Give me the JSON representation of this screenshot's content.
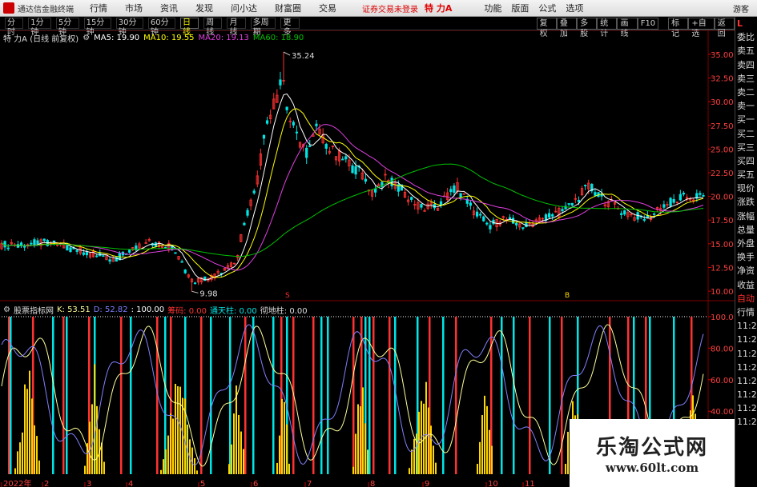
{
  "topbar": {
    "app_name": "通达信金融终端",
    "menus": [
      "行情",
      "市场",
      "资讯",
      "发现",
      "问小达",
      "财富圈",
      "交易"
    ],
    "notice": "证券交易未登录",
    "stock_title": "特 力A",
    "right_menus": [
      "功能",
      "版面",
      "公式",
      "选项"
    ],
    "guest": "游客"
  },
  "periods": [
    "分时",
    "1分钟",
    "5分钟",
    "15分钟",
    "30分钟",
    "60分钟",
    "日线",
    "周线",
    "月线",
    "多周期",
    "更多"
  ],
  "active_period": "日线",
  "tools": [
    "复权",
    "叠加",
    "多股",
    "统计",
    "画线",
    "F10",
    "标记",
    "+自选",
    "返回"
  ],
  "info": {
    "name": "特 力A (日线 前复权)",
    "ma5": "MA5: 19.90",
    "ma10": "MA10: 19.55",
    "ma20": "MA20: 19.13",
    "ma60": "MA60: 18.90"
  },
  "indicator": {
    "name": "股票指标网",
    "k": "K: 53.51",
    "d": "D: 52.82",
    "v100": ": 100.00",
    "chip": "筹码: 0.00",
    "sky": "通天柱: 0.00",
    "ground": "彻地柱: 0.00"
  },
  "price_axis": [
    "35.00",
    "32.50",
    "30.00",
    "27.50",
    "25.00",
    "22.50",
    "20.00",
    "17.50",
    "15.00",
    "12.50",
    "10.00"
  ],
  "ind_axis": [
    "100.0",
    "80.00",
    "60.00",
    "40.00"
  ],
  "annotations": {
    "high": "35.24",
    "low": "9.98",
    "mark1": "S",
    "mark2": "B"
  },
  "months": [
    "2022年",
    "2",
    "3",
    "4",
    "5",
    "6",
    "7",
    "8",
    "9",
    "10",
    "11"
  ],
  "right_panel": [
    "委比",
    "卖五",
    "卖四",
    "卖三",
    "卖二",
    "卖一",
    "买一",
    "买二",
    "买三",
    "买四",
    "买五",
    "现价",
    "涨跌",
    "涨幅",
    "总量",
    "外盘",
    "换手",
    "净资",
    "收益",
    "自动",
    "行情",
    "11:2",
    "11:2",
    "11:2",
    "11:2",
    "11:2",
    "11:2",
    "11:2",
    "11:2"
  ],
  "watermark": {
    "title": "乐淘公式网",
    "url": "www.60lt.com"
  },
  "colors": {
    "up": "#ff3232",
    "down": "#00e5e5",
    "ma5": "#ffffff",
    "ma10": "#ffff00",
    "ma20": "#e040e0",
    "ma60": "#00c000",
    "k": "#ffff99",
    "d": "#8080ff"
  }
}
